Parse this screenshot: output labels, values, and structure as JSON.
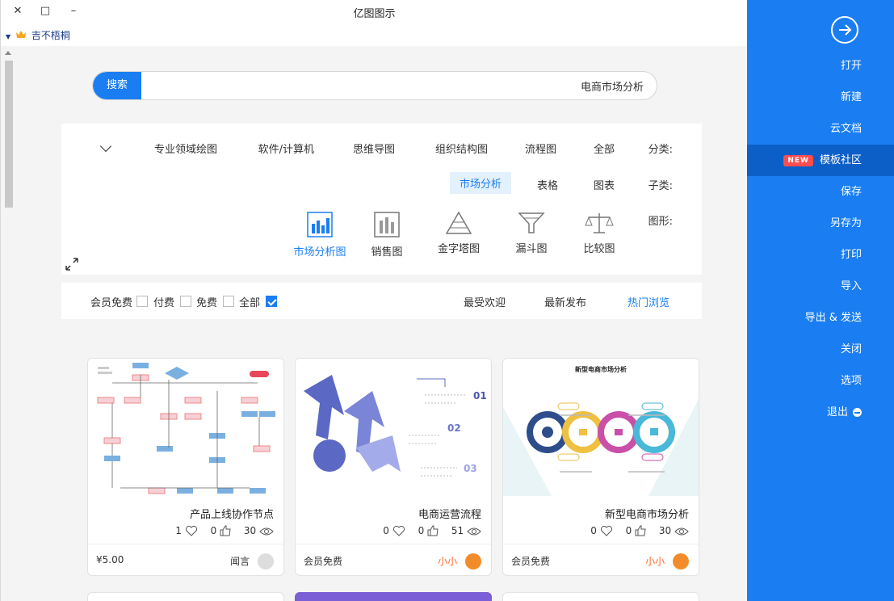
{
  "app": {
    "title": "亿图图示"
  },
  "window": {
    "minimize": "–",
    "maximize": "□",
    "close": "✕"
  },
  "user": {
    "name": "吉不梧桐"
  },
  "sidebar": {
    "items": [
      {
        "label": "打开"
      },
      {
        "label": "新建"
      },
      {
        "label": "云文档"
      },
      {
        "label": "模板社区",
        "badge": "NEW",
        "active": true
      },
      {
        "label": "保存"
      },
      {
        "label": "另存为"
      },
      {
        "label": "打印"
      },
      {
        "label": "导入"
      },
      {
        "label": "导出 & 发送"
      },
      {
        "label": "关闭"
      },
      {
        "label": "选项"
      },
      {
        "label": "退出"
      }
    ]
  },
  "search": {
    "button": "搜索",
    "value": "电商市场分析"
  },
  "filter": {
    "category_label": "分类:",
    "categories": [
      "全部",
      "流程图",
      "组织结构图",
      "思维导图",
      "软件/计算机",
      "专业领域绘图"
    ],
    "subtype_label": "子类:",
    "subtypes": [
      "图表",
      "表格",
      "市场分析"
    ],
    "subtype_selected": "市场分析",
    "shape_label": "图形:",
    "shapes": [
      "比较图",
      "漏斗图",
      "金字塔图",
      "销售图",
      "市场分析图"
    ],
    "shape_selected": "市场分析图"
  },
  "sort": {
    "tabs": [
      "热门浏览",
      "最新发布",
      "最受欢迎"
    ],
    "active": "热门浏览",
    "filters": [
      {
        "label": "全部",
        "checked": true
      },
      {
        "label": "免费",
        "checked": false
      },
      {
        "label": "付费",
        "checked": false
      },
      {
        "label": "会员免费",
        "checked": false
      }
    ]
  },
  "cards": [
    {
      "title": "新型电商市场分析",
      "views": "30",
      "likes": "0",
      "favorites": "0",
      "author": "小小",
      "price": "会员免费",
      "thumb_title": "新型电商市场分析"
    },
    {
      "title": "电商运营流程",
      "views": "51",
      "likes": "0",
      "favorites": "0",
      "author": "小小",
      "price": "会员免费",
      "labels": [
        "01",
        "02",
        "03"
      ]
    },
    {
      "title": "产品上线协作节点",
      "views": "30",
      "likes": "0",
      "favorites": "1",
      "author": "闻言",
      "price": "¥5.00"
    }
  ],
  "colors": {
    "accent": "#1a7ef2",
    "sidebar_active": "#0d5fc8",
    "badge": "#ff4d4f",
    "author": "#ff6a2b"
  }
}
